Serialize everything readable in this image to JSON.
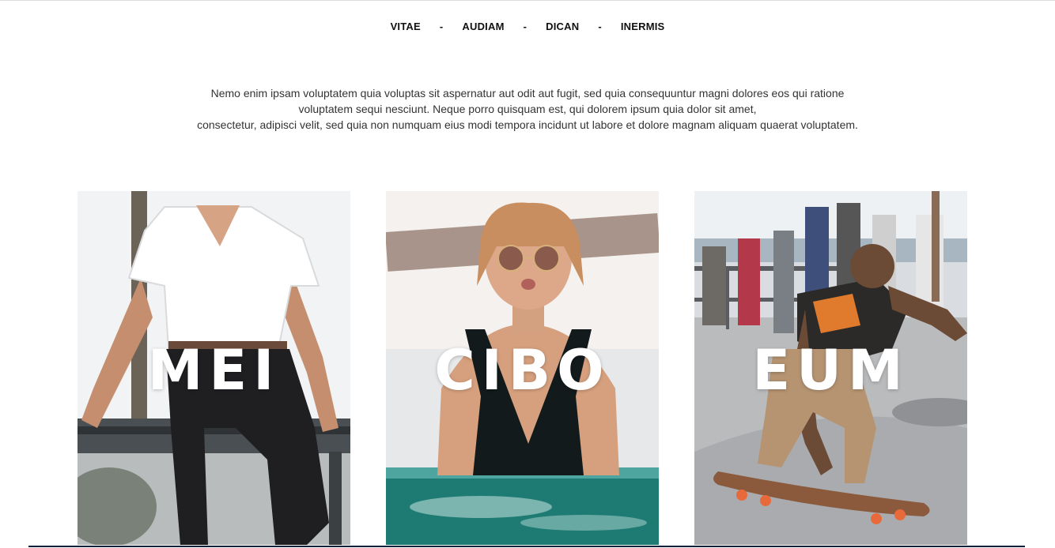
{
  "nav": {
    "items": [
      "VITAE",
      "AUDIAM",
      "DICAN",
      "INERMIS"
    ],
    "separator": "-"
  },
  "intro": {
    "line1": "Nemo enim ipsam voluptatem quia voluptas sit aspernatur aut odit aut fugit, sed quia consequuntur magni dolores eos qui ratione",
    "line2": "voluptatem sequi nesciunt. Neque porro quisquam est, qui dolorem ipsum quia dolor sit amet,",
    "line3": "consectetur, adipisci velit, sed quia non numquam eius modi tempora incidunt ut labore et dolore magnam aliquam quaerat voluptatem."
  },
  "cards": [
    {
      "title": "MEI"
    },
    {
      "title": "CIBO"
    },
    {
      "title": "EUM"
    }
  ]
}
